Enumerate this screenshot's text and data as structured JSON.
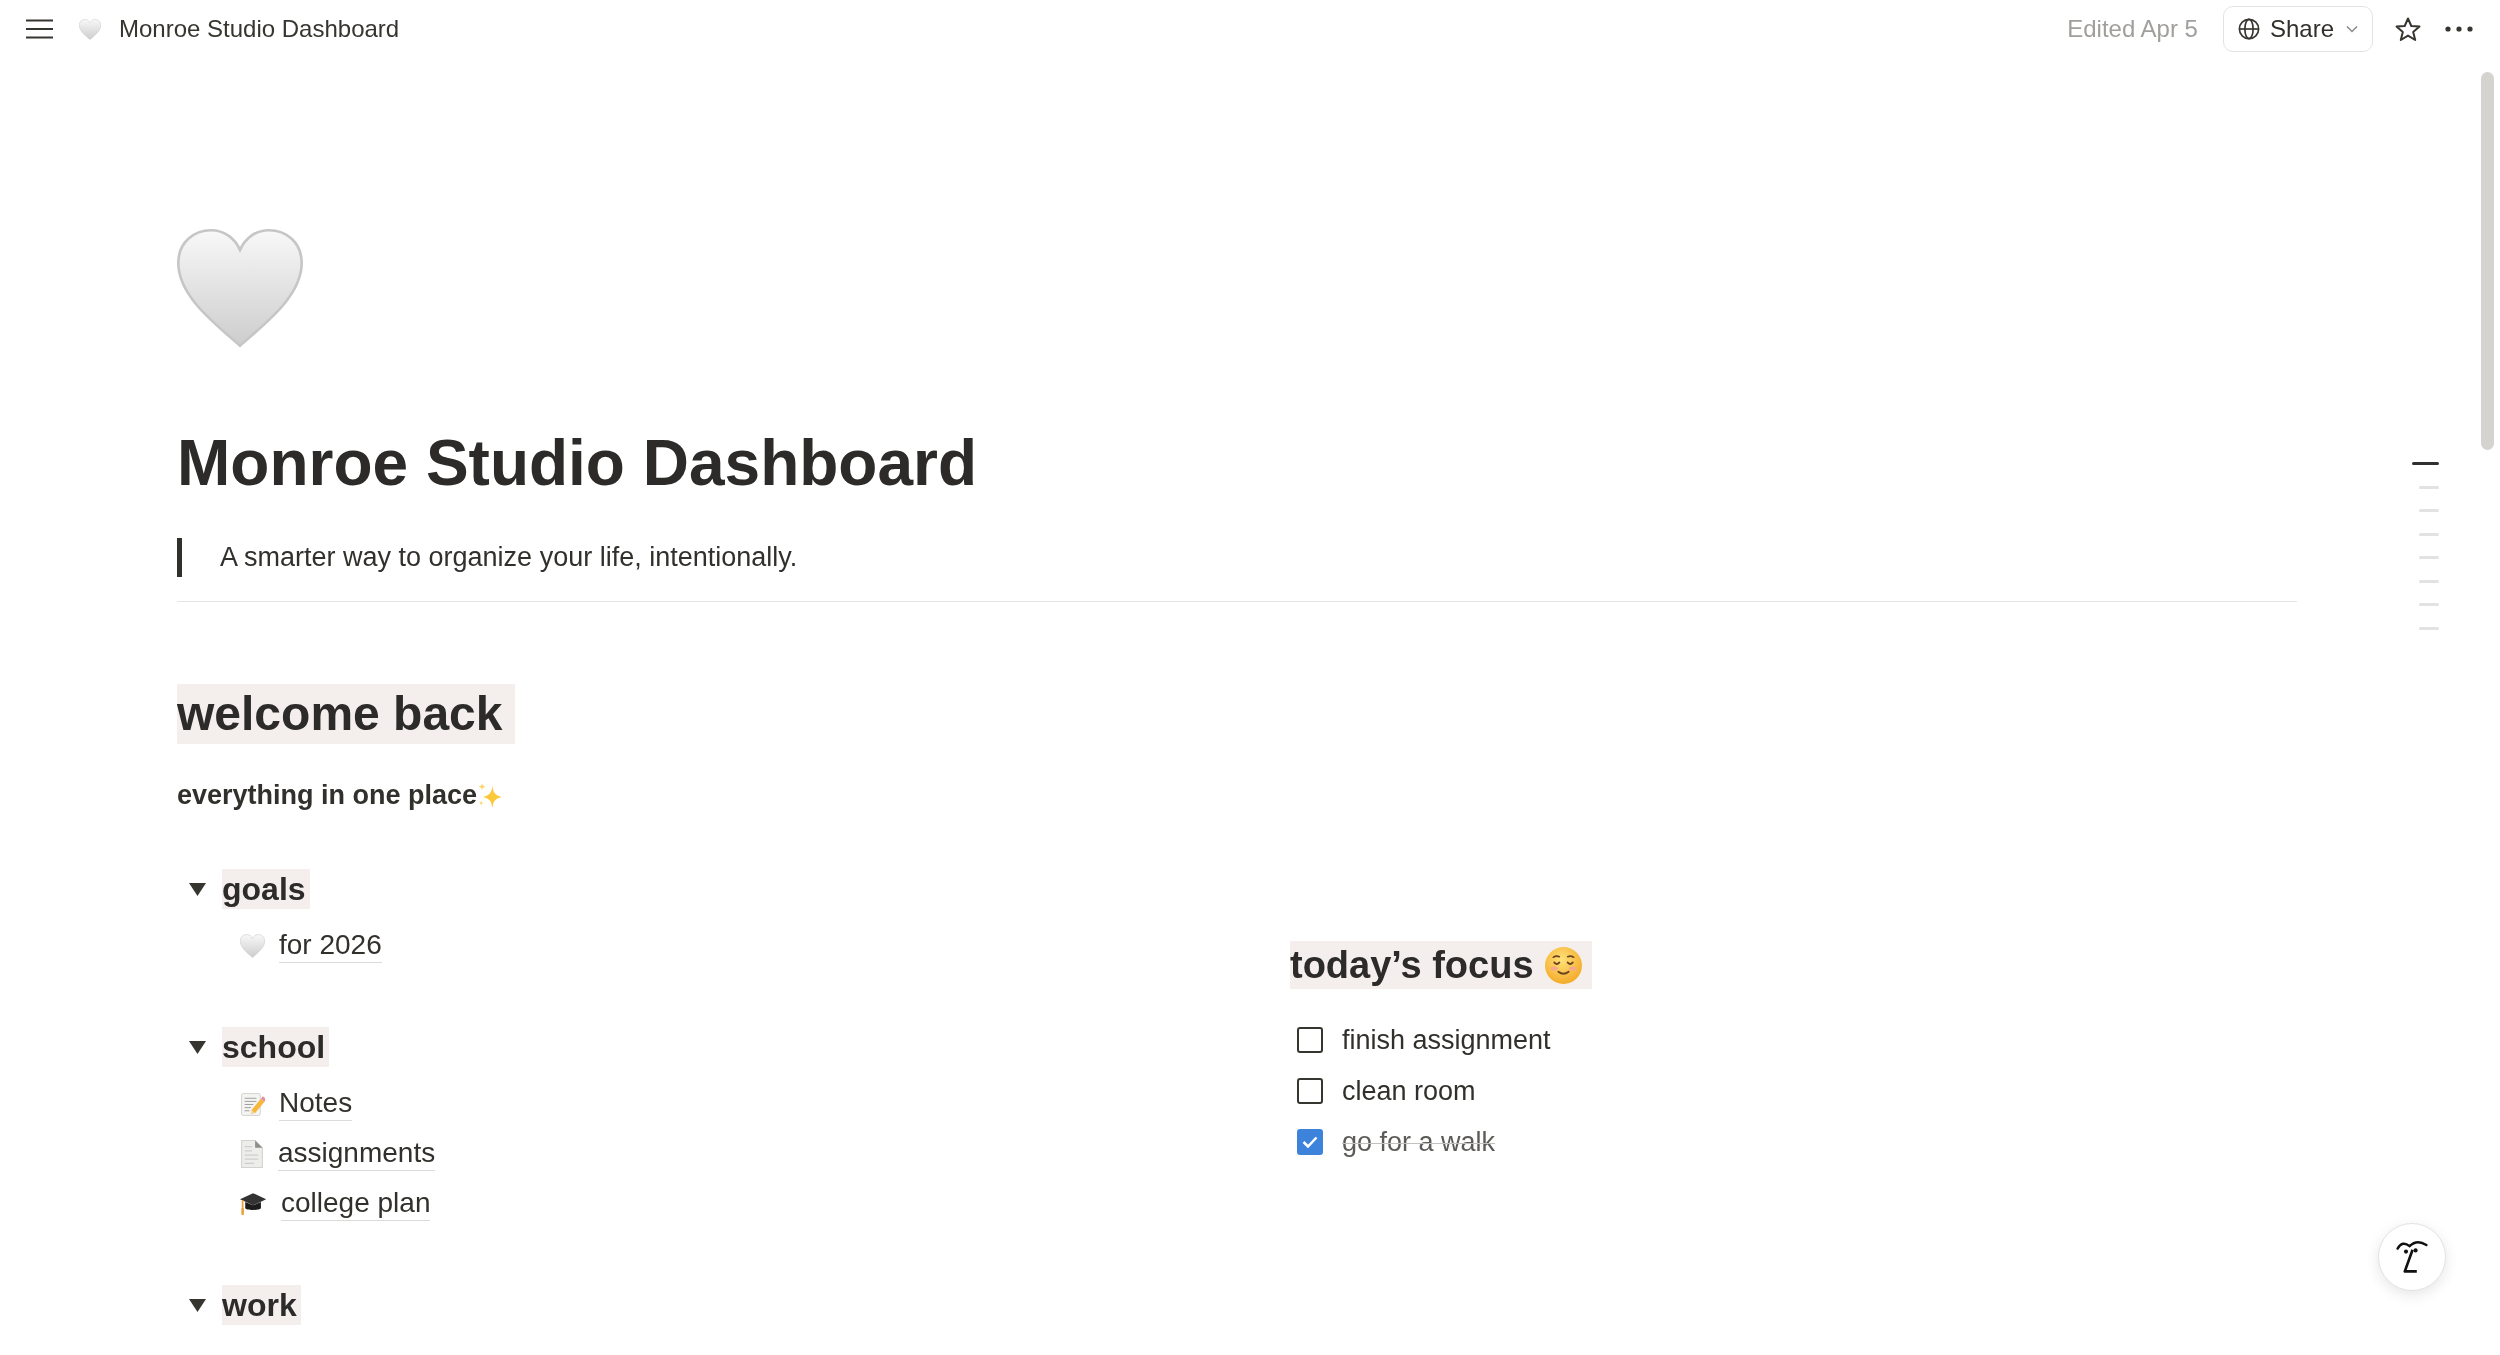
{
  "topbar": {
    "page_title": "Monroe Studio Dashboard",
    "edited": "Edited Apr 5",
    "share_label": "Share"
  },
  "page": {
    "title": "Monroe Studio Dashboard",
    "quote": "A smarter way to organize your life, intentionally."
  },
  "welcome": {
    "heading": "welcome back",
    "tagline": "everything in one place"
  },
  "toggles": [
    {
      "heading": "goals",
      "expanded": true,
      "children": [
        {
          "kind": "heart",
          "label": "for 2026"
        }
      ]
    },
    {
      "heading": "school",
      "expanded": true,
      "children": [
        {
          "kind": "memo",
          "label": "Notes"
        },
        {
          "kind": "page",
          "label": "assignments"
        },
        {
          "kind": "cap",
          "label": "college plan"
        }
      ]
    },
    {
      "heading": "work",
      "expanded": true
    }
  ],
  "focus": {
    "heading": "today’s focus",
    "todos": [
      {
        "label": "finish assignment",
        "checked": false
      },
      {
        "label": "clean room",
        "checked": false
      },
      {
        "label": "go for a walk",
        "checked": true
      }
    ]
  },
  "outline": [
    {
      "selected": true
    },
    {
      "selected": false
    },
    {
      "selected": false
    },
    {
      "selected": false
    },
    {
      "selected": false
    },
    {
      "selected": false
    },
    {
      "selected": false
    },
    {
      "selected": false
    }
  ]
}
